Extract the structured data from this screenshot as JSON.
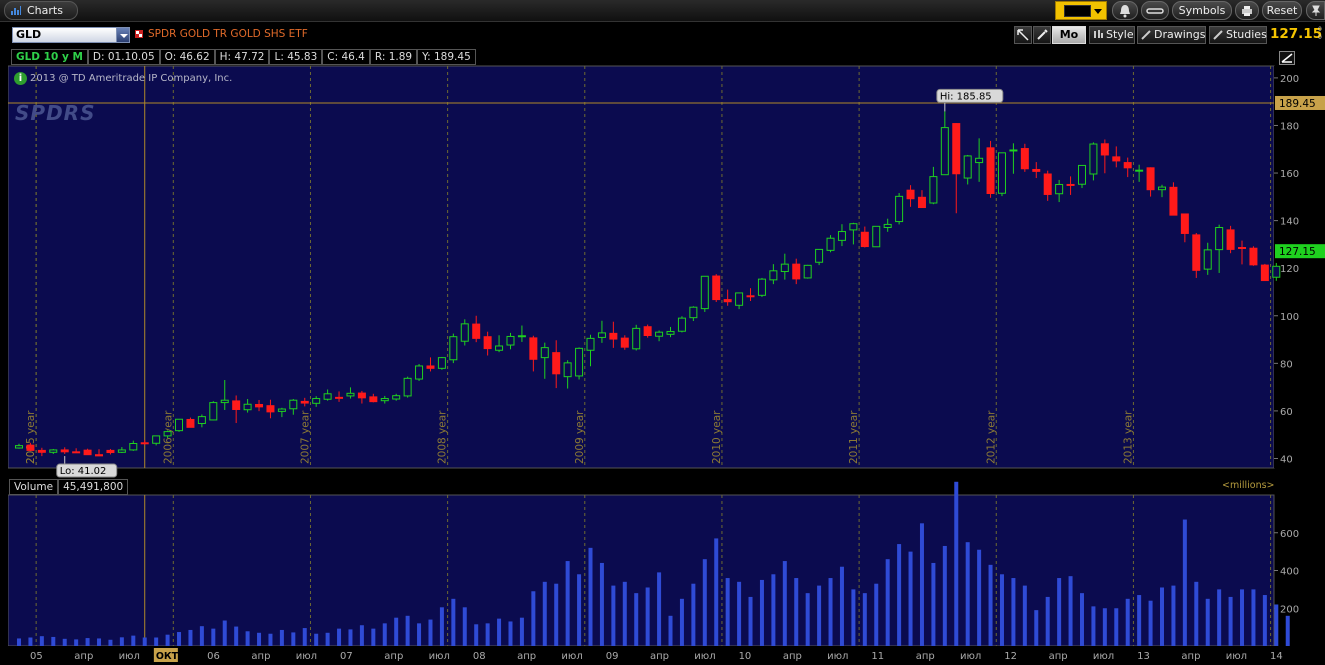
{
  "app": {
    "tab_label": "Charts",
    "colors": {
      "background": "#000000",
      "plot_bg": "#0b0b4f",
      "grid": "#6e6a31",
      "up": "#1fd11f",
      "down": "#ff1a1a",
      "volume": "#2f4bd6",
      "accent": "#f5c400"
    }
  },
  "topbar": {
    "symbols_label": "Symbols",
    "reset_label": "Reset"
  },
  "symbar": {
    "symbol": "GLD",
    "name": "SPDR GOLD TR GOLD SHS ETF",
    "aggregation": "Mo",
    "style_label": "Style",
    "drawings_label": "Drawings",
    "studies_label": "Studies",
    "last_price": "127.15"
  },
  "info": {
    "sym_period": "GLD 10 y M",
    "date": "D: 01.10.05",
    "open": "O: 46.62",
    "high": "H: 47.72",
    "low": "L: 45.83",
    "close": "C: 46.4",
    "range": "R: 1.89",
    "y": "Y: 189.45",
    "copyright": "2013 @ TD Ameritrade IP Company, Inc.",
    "watermark": "SPDRS"
  },
  "volume_panel": {
    "label": "Volume",
    "value": "45,491,800",
    "units": "<millions>"
  },
  "chart_data": [
    {
      "type": "candlestick",
      "title": "GLD 10 y M",
      "y_axis_ticks": [
        40,
        60,
        80,
        100,
        120,
        140,
        160,
        180,
        200
      ],
      "ylim": [
        36,
        205
      ],
      "crosshair_value": "189.45",
      "last_value": "127.15",
      "hi_label": "Hi: 185.85",
      "lo_label": "Lo: 41.02",
      "year_labels": [
        "2005 year",
        "2006 year",
        "2007 year",
        "2008 year",
        "2009 year",
        "2010 year",
        "2011 year",
        "2012 year",
        "2013 year"
      ],
      "first_year_label_partial": "200",
      "months": [
        "2004-11",
        "2004-12",
        "2005-01",
        "2005-02",
        "2005-03",
        "2005-04",
        "2005-05",
        "2005-06",
        "2005-07",
        "2005-08",
        "2005-09",
        "2005-10",
        "2005-11",
        "2005-12",
        "2006-01",
        "2006-02",
        "2006-03",
        "2006-04",
        "2006-05",
        "2006-06",
        "2006-07",
        "2006-08",
        "2006-09",
        "2006-10",
        "2006-11",
        "2006-12",
        "2007-01",
        "2007-02",
        "2007-03",
        "2007-04",
        "2007-05",
        "2007-06",
        "2007-07",
        "2007-08",
        "2007-09",
        "2007-10",
        "2007-11",
        "2007-12",
        "2008-01",
        "2008-02",
        "2008-03",
        "2008-04",
        "2008-05",
        "2008-06",
        "2008-07",
        "2008-08",
        "2008-09",
        "2008-10",
        "2008-11",
        "2008-12",
        "2009-01",
        "2009-02",
        "2009-03",
        "2009-04",
        "2009-05",
        "2009-06",
        "2009-07",
        "2009-08",
        "2009-09",
        "2009-10",
        "2009-11",
        "2009-12",
        "2010-01",
        "2010-02",
        "2010-03",
        "2010-04",
        "2010-05",
        "2010-06",
        "2010-07",
        "2010-08",
        "2010-09",
        "2010-10",
        "2010-11",
        "2010-12",
        "2011-01",
        "2011-02",
        "2011-03",
        "2011-04",
        "2011-05",
        "2011-06",
        "2011-07",
        "2011-08",
        "2011-09",
        "2011-10",
        "2011-11",
        "2011-12",
        "2012-01",
        "2012-02",
        "2012-03",
        "2012-04",
        "2012-05",
        "2012-06",
        "2012-07",
        "2012-08",
        "2012-09",
        "2012-10",
        "2012-11",
        "2012-12",
        "2013-01",
        "2013-02",
        "2013-03",
        "2013-04",
        "2013-05",
        "2013-06",
        "2013-07",
        "2013-08",
        "2013-09",
        "2013-10",
        "2013-11",
        "2013-12",
        "2014-01"
      ],
      "open": [
        44.4,
        45.6,
        43.4,
        42.6,
        43.6,
        42.8,
        43.5,
        41.6,
        43.4,
        42.6,
        43.6,
        46.6,
        46.4,
        49.5,
        51.7,
        56.4,
        54.7,
        56.2,
        63.5,
        64.2,
        60.5,
        62.7,
        62.2,
        59.8,
        60.9,
        64,
        63.2,
        64.9,
        65.7,
        66.3,
        67.5,
        65.9,
        64.3,
        65,
        66.3,
        73.4,
        78.9,
        77.9,
        81.5,
        89.3,
        96.5,
        91.2,
        85.5,
        87.7,
        91.4,
        90.7,
        82.4,
        84.5,
        74.4,
        74.7,
        85.5,
        90.9,
        92.6,
        90.6,
        86.1,
        95.4,
        91.4,
        92.2,
        93.5,
        99.2,
        103,
        116.7,
        106.8,
        104.4,
        108.4,
        108.6,
        115.1,
        118.6,
        121.7,
        115.9,
        122.5,
        127.5,
        131.7,
        136.1,
        135.1,
        129,
        137.1,
        139.6,
        152.8,
        149.8,
        147.4,
        159.3,
        180.8,
        157.9,
        164.4,
        170.6,
        151.5,
        169.6,
        170.3,
        161.5,
        159.6,
        151.3,
        155.2,
        155.3,
        159.6,
        172.3,
        166.8,
        164.4,
        160.9,
        162.2,
        153,
        154,
        142.8,
        134,
        119.6,
        127.8,
        136.1,
        128.7,
        128.4,
        121.3,
        116.2,
        120.2
      ],
      "high": [
        46.2,
        46.6,
        44.5,
        44,
        44.7,
        44.3,
        44.1,
        43.9,
        44,
        44.8,
        47.5,
        47.7,
        49.6,
        51.8,
        56.5,
        57.2,
        58.5,
        64.1,
        73,
        66.5,
        65,
        64.6,
        64.7,
        61.3,
        65,
        65.5,
        66.2,
        69,
        68.2,
        69.9,
        68.4,
        67.2,
        66.3,
        67.2,
        74.4,
        79.7,
        82.5,
        82.7,
        92.5,
        98.5,
        100,
        93.3,
        91.8,
        92.8,
        95.9,
        91.6,
        88.7,
        89.7,
        81.3,
        86.7,
        92,
        97.9,
        97.5,
        91.8,
        96.2,
        96.3,
        93.8,
        95.3,
        99.8,
        104,
        114.8,
        117.5,
        111,
        109.5,
        111.6,
        115.9,
        121.7,
        126.1,
        124,
        121.4,
        127,
        133.9,
        138.5,
        139.1,
        137.5,
        137.4,
        140.8,
        151.6,
        154.9,
        152.8,
        162.6,
        185.9,
        181,
        167.6,
        174.6,
        173.5,
        167.5,
        172.5,
        172.3,
        164.6,
        161,
        157.1,
        158.6,
        163,
        172.9,
        174.1,
        171.2,
        166.5,
        163.5,
        162.4,
        155.1,
        156.1,
        142.8,
        134.8,
        130.7,
        138.3,
        137.8,
        131.6,
        129.2,
        121.8,
        122.2,
        126.8
      ],
      "low": [
        44.1,
        43.1,
        41,
        41.9,
        41.9,
        42.4,
        41.5,
        41,
        41.7,
        42.3,
        43.2,
        45.8,
        45.5,
        48.6,
        51.2,
        53.4,
        53.1,
        56,
        60.4,
        54.9,
        59.3,
        59.9,
        56.9,
        57.4,
        58.4,
        61.9,
        61.7,
        64.3,
        63.8,
        65.2,
        63.1,
        63.6,
        63.1,
        64.3,
        65.6,
        72.6,
        76.6,
        77.3,
        80.1,
        87.5,
        88.9,
        83.3,
        84.7,
        85.9,
        89,
        76.6,
        73.5,
        69.6,
        69.4,
        73.2,
        78.8,
        88.6,
        86.5,
        85.7,
        85.4,
        90.8,
        89.3,
        91,
        93,
        97.8,
        101.6,
        105.8,
        104.2,
        102.8,
        106.2,
        107.9,
        113.3,
        115.2,
        113.3,
        115.6,
        121.3,
        126.7,
        129.3,
        130,
        128.7,
        129.2,
        135.3,
        138.4,
        145.8,
        145.7,
        146.9,
        160.2,
        143.1,
        155.2,
        156.3,
        149.6,
        150.3,
        159.7,
        160.5,
        157.9,
        148.3,
        147.8,
        150.8,
        153.7,
        156.9,
        159.9,
        162.4,
        158.3,
        156.3,
        150.1,
        149.9,
        143.1,
        130.9,
        115.9,
        117.2,
        118,
        126.3,
        121.6,
        121,
        116.7,
        114.7,
        118.6
      ],
      "close": [
        45.4,
        43.4,
        42.6,
        43.6,
        42.8,
        42.7,
        41.6,
        41.1,
        42.5,
        43.6,
        46.3,
        46.4,
        49.5,
        51.3,
        56.5,
        53.1,
        57.6,
        63.5,
        64.5,
        60.6,
        62.8,
        61.7,
        59.6,
        60.8,
        64.5,
        63.3,
        65.2,
        67.2,
        65.3,
        67.4,
        65.5,
        63.9,
        65.2,
        66.4,
        73.7,
        78.9,
        77.9,
        82.4,
        91.2,
        96.6,
        90.5,
        86.2,
        87.3,
        91.3,
        91.6,
        81.7,
        86.6,
        75.6,
        80.2,
        86.3,
        90.5,
        92.8,
        90.2,
        86.8,
        94.7,
        91.7,
        93.1,
        93.4,
        99,
        103.6,
        116.6,
        106.8,
        105.9,
        109.6,
        108,
        115.4,
        118.9,
        121.7,
        115.5,
        121.2,
        127.9,
        132.6,
        135.4,
        138.7,
        129.1,
        137.6,
        138.4,
        150.2,
        149.2,
        145.5,
        158.5,
        179.1,
        159.7,
        167.2,
        166.2,
        151.4,
        168.5,
        169.7,
        161.8,
        160.7,
        151,
        155.2,
        155.1,
        163.2,
        172.2,
        167.6,
        165.1,
        162.2,
        161.2,
        153,
        154.1,
        142.3,
        134.6,
        119.1,
        127.7,
        137.1,
        127.9,
        128.6,
        121.4,
        114.8,
        120.8,
        127.2
      ],
      "volume_axis_ticks": [
        200,
        400,
        600
      ],
      "volume_ylim": [
        0,
        800
      ],
      "volume_millions": [
        40,
        45,
        52,
        48,
        38,
        35,
        42,
        40,
        33,
        46,
        55,
        45,
        45,
        60,
        74,
        85,
        105,
        92,
        135,
        103,
        78,
        70,
        65,
        85,
        72,
        95,
        65,
        70,
        92,
        88,
        110,
        92,
        120,
        150,
        160,
        120,
        140,
        205,
        250,
        205,
        115,
        120,
        145,
        130,
        150,
        290,
        340,
        330,
        450,
        380,
        520,
        440,
        320,
        340,
        280,
        310,
        390,
        160,
        250,
        330,
        460,
        570,
        360,
        340,
        260,
        350,
        380,
        450,
        360,
        280,
        320,
        360,
        420,
        300,
        280,
        330,
        460,
        540,
        500,
        650,
        440,
        530,
        870,
        550,
        510,
        430,
        380,
        360,
        320,
        190,
        260,
        360,
        370,
        280,
        210,
        200,
        200,
        250,
        270,
        240,
        310,
        320,
        670,
        340,
        250,
        300,
        260,
        300,
        300,
        270,
        220,
        160
      ],
      "x_axis_labels": [
        "05",
        "апр",
        "июл",
        "ОКТ",
        "06",
        "апр",
        "июл",
        "07",
        "апр",
        "июл",
        "08",
        "апр",
        "июл",
        "09",
        "апр",
        "июл",
        "10",
        "апр",
        "июл",
        "11",
        "апр",
        "июл",
        "12",
        "апр",
        "июл",
        "13",
        "апр",
        "июл",
        "14"
      ]
    }
  ]
}
